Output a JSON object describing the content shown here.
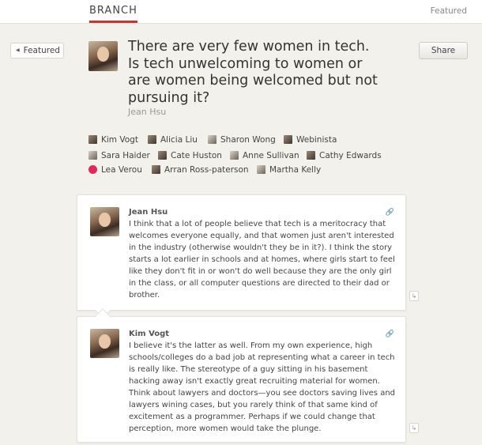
{
  "header": {
    "brand": "BRANCH",
    "featured_link": "Featured"
  },
  "nav": {
    "back_label": "Featured",
    "share_label": "Share"
  },
  "question": {
    "title": "There are very few women in tech. Is tech unwelcoming to women or are women being welcomed but not pursuing it?",
    "asker": "Jean Hsu"
  },
  "participants": [
    "Kim Vogt",
    "Alicia Liu",
    "Sharon Wong",
    "Webinista",
    "Sara Haider",
    "Cate Huston",
    "Anne Sullivan",
    "Cathy Edwards",
    "Lea Verou",
    "Arran Ross-paterson",
    "Martha Kelly"
  ],
  "posts": [
    {
      "author": "Jean Hsu",
      "text": "I think that a lot of people believe that tech is a meritocracy that welcomes everyone equally, and that women just aren't interested in the industry (otherwise wouldn't they be in it?). I think the story starts a lot earlier in schools and at homes, where girls start to feel like they don't fit in or won't do well because they are the only girl in the class, or all computer questions are directed to their dad or brother."
    },
    {
      "author": "Kim Vogt",
      "text": "I believe it's the latter as well. From my own experience, high schools/colleges do a bad job at representing what a career in tech is really like. The stereotype of a guy sitting in his basement hacking away isn't exactly great recruiting material for women. Think about lawyers and doctors—you see doctors saving lives and lawyers wining cases, but you rarely think of that same kind of excitement as a programmer. Perhaps if we could change that perception, more women would take the plunge."
    }
  ],
  "icons": {
    "link": "link-icon",
    "reply": "reply-icon",
    "back": "triangle-left-icon"
  },
  "colors": {
    "accent": "#d3312a",
    "background": "#f3f1ec",
    "lea_verou_avatar": "#e2295a"
  }
}
